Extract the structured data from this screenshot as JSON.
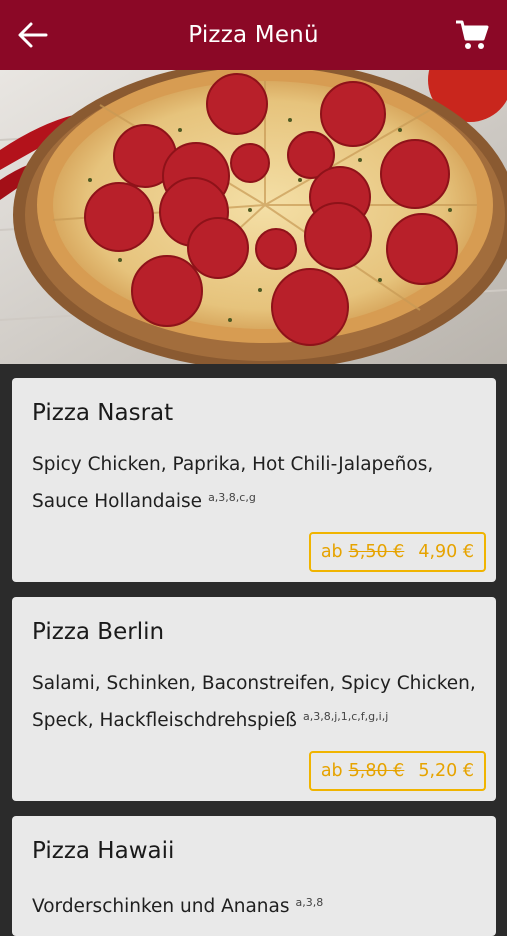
{
  "header": {
    "title": "Pizza Menü",
    "back_icon": "arrow-left-icon",
    "cart_icon": "shopping-cart-icon"
  },
  "colors": {
    "header_bg": "#8b0826",
    "accent": "#f0b400",
    "card_bg": "#e9e9e9",
    "page_bg": "#2b2b2b"
  },
  "items": [
    {
      "name": "Pizza Nasrat",
      "description": "Spicy Chicken, Paprika, Hot Chili-Jalapeños, Sauce Hollandaise",
      "allergens": "a,3,8,c,g",
      "price_prefix": "ab",
      "old_price": "5,50 €",
      "price": "4,90 €"
    },
    {
      "name": "Pizza Berlin",
      "description": "Salami, Schinken, Baconstreifen, Spicy Chicken, Speck, Hackfleischdrehspieß",
      "allergens": "a,3,8,j,1,c,f,g,i,j",
      "price_prefix": "ab",
      "old_price": "5,80 €",
      "price": "5,20 €"
    },
    {
      "name": "Pizza Hawaii",
      "description": "Vorderschinken und Ananas",
      "allergens": "a,3,8"
    }
  ]
}
